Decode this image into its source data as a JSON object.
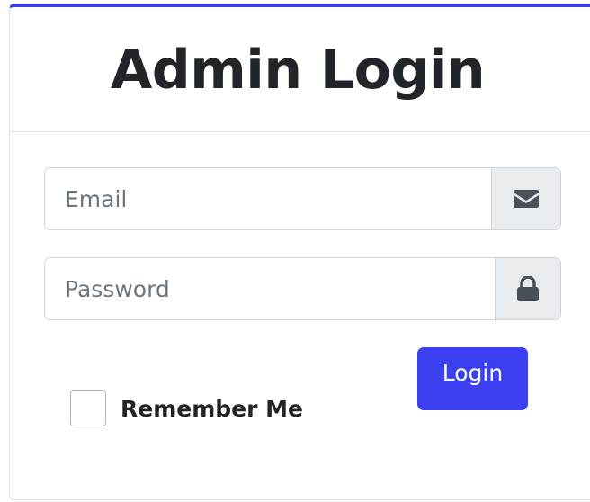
{
  "header": {
    "title": "Admin Login"
  },
  "form": {
    "email": {
      "placeholder": "Email",
      "value": "",
      "icon": "envelope-icon"
    },
    "password": {
      "placeholder": "Password",
      "value": "",
      "icon": "lock-icon"
    },
    "login_label": "Login",
    "remember_label": "Remember Me",
    "remember_checked": false
  },
  "colors": {
    "accent": "#3b3ff0",
    "card_top_border": "#3b3fe0",
    "addon_bg": "#e9ecef",
    "text": "#212529",
    "placeholder": "#6c757d"
  }
}
